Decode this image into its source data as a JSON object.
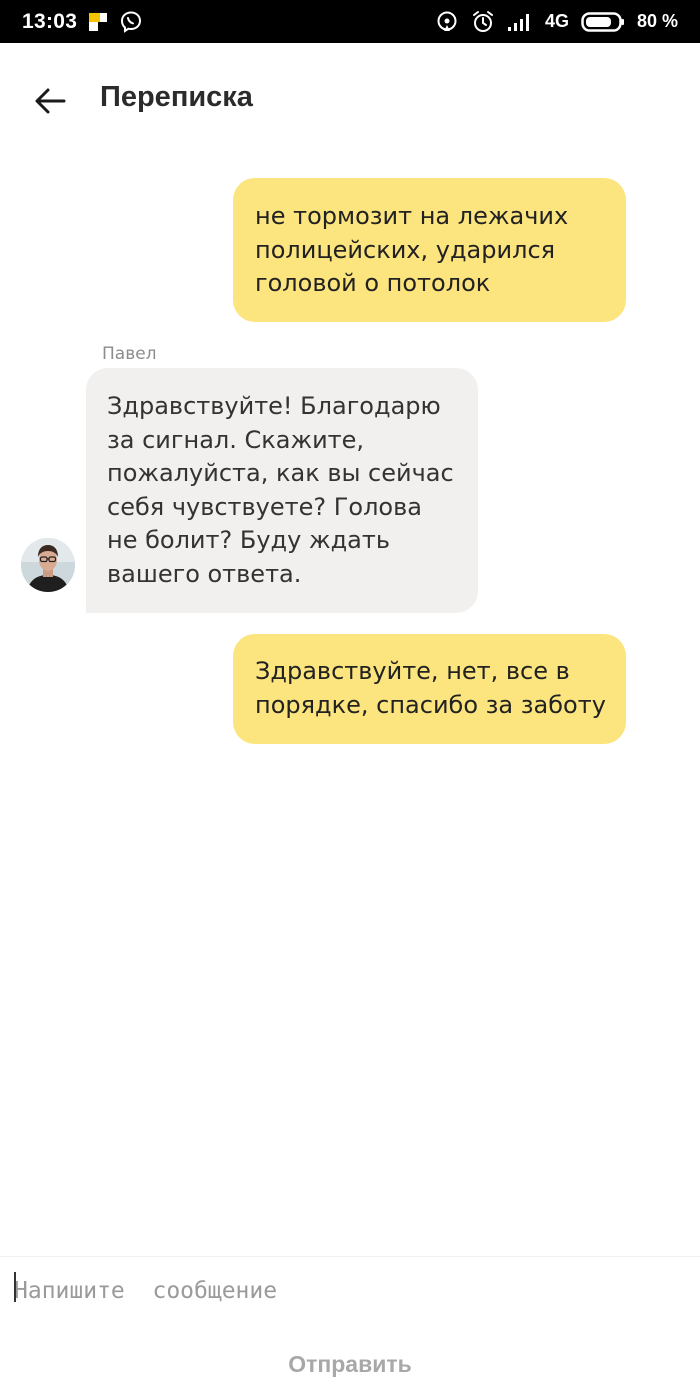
{
  "status_bar": {
    "time": "13:03",
    "network": "4G",
    "battery": "80 %",
    "icons": [
      "yandex-taxi-icon",
      "viber-icon",
      "hotspot-icon",
      "alarm-icon",
      "signal-icon",
      "battery-icon"
    ]
  },
  "header": {
    "title": "Переписка",
    "back_icon": "arrow-left-icon"
  },
  "messages": [
    {
      "direction": "outgoing",
      "text": "не тормозит на лежачих полицейских, ударился головой о потолок"
    },
    {
      "direction": "incoming",
      "sender": "Павел",
      "text": "Здравствуйте! Благодарю за сигнал. Скажите, пожалуйста, как вы сейчас себя чувствуете? Голова не болит? Буду ждать вашего ответа."
    },
    {
      "direction": "outgoing",
      "text": "Здравствуйте, нет, все в порядке, спасибо за заботу"
    }
  ],
  "composer": {
    "value": "",
    "placeholder": "Напишите  сообщение",
    "send_label": "Отправить"
  },
  "colors": {
    "outgoing_bubble": "#fce57e",
    "incoming_bubble": "#f1f0ee",
    "status_bar": "#000000",
    "send_disabled": "#a8a8a8"
  }
}
